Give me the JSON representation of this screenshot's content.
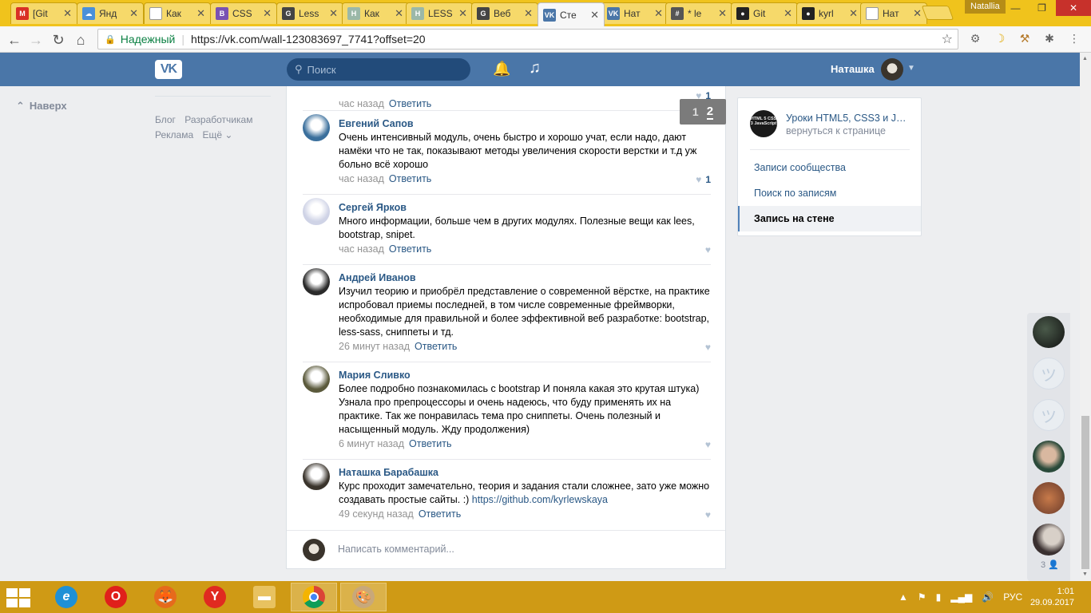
{
  "browser": {
    "tabs": [
      {
        "label": "[Git",
        "icon": "gmail-icon",
        "color": "#d93025",
        "glyph": "M"
      },
      {
        "label": "Янд",
        "icon": "yandex-weather-icon",
        "color": "#4a90d9",
        "glyph": "☁"
      },
      {
        "label": "Как",
        "icon": "page-icon",
        "color": "#ffffff",
        "glyph": ""
      },
      {
        "label": "CSS",
        "icon": "bootstrap-icon",
        "color": "#7952b3",
        "glyph": "B"
      },
      {
        "label": "Less",
        "icon": "geekbrains-icon",
        "color": "#444444",
        "glyph": "G"
      },
      {
        "label": "Как",
        "icon": "habr-icon",
        "color": "#9bb8a8",
        "glyph": "H"
      },
      {
        "label": "LESS",
        "icon": "habr-icon",
        "color": "#9bb8a8",
        "glyph": "H"
      },
      {
        "label": "Веб",
        "icon": "geekbrains-icon",
        "color": "#444444",
        "glyph": "G"
      },
      {
        "label": "Сте",
        "icon": "vk-icon",
        "color": "#4a76a8",
        "glyph": "VK",
        "active": true
      },
      {
        "label": "Нат",
        "icon": "vk-icon",
        "color": "#4a76a8",
        "glyph": "VK"
      },
      {
        "label": "* le",
        "icon": "slack-icon",
        "color": "#555555",
        "glyph": "#"
      },
      {
        "label": "Git",
        "icon": "github-icon",
        "color": "#222222",
        "glyph": "●"
      },
      {
        "label": "kyrl",
        "icon": "github-icon",
        "color": "#222222",
        "glyph": "●"
      },
      {
        "label": "Нат",
        "icon": "page-icon",
        "color": "#ffffff",
        "glyph": ""
      }
    ],
    "profile_name": "Natallia",
    "secure_label": "Надежный",
    "url": "https://vk.com/wall-123083697_7741?offset=20"
  },
  "vk": {
    "search_placeholder": "Поиск",
    "user_name": "Наташка",
    "up_button": "Наверх",
    "footer_links": [
      "Блог",
      "Разработчикам",
      "Реклама",
      "Ещё ⌄"
    ],
    "pager": {
      "prev": "1",
      "current": "2"
    },
    "comments": [
      {
        "author": "",
        "text": "",
        "time": "час назад",
        "reply": "Ответить",
        "likes": "1",
        "avatar_color": "#ffffff"
      },
      {
        "author": "Евгений Сапов",
        "text": "Очень интенсивный модуль, очень быстро и хорошо учат, если надо, дают намёки что не так, показывают методы увеличения скорости верстки и т.д уж больно всё хорошо",
        "time": "час назад",
        "reply": "Ответить",
        "likes": "1",
        "avatar_color": "#3a6f9c"
      },
      {
        "author": "Сергей Ярков",
        "text": "Много информации, больше чем в других модулях. Полезные вещи как lees, bootstrap, snipet.",
        "time": "час назад",
        "reply": "Ответить",
        "likes": "",
        "avatar_color": "#cfd3e6"
      },
      {
        "author": "Андрей Иванов",
        "text": "Изучил теорию и приобрёл представление о современной вёрстке, на практике испробовал приемы последней, в том числе современные фреймворки, необходимые для правильной и более эффективной веб разработке: bootstrap, less-sass, сниппеты и тд.",
        "time": "26 минут назад",
        "reply": "Ответить",
        "likes": "",
        "avatar_color": "#2b2b2b"
      },
      {
        "author": "Мария Сливко",
        "text": "Более подробно познакомилась с bootstrap И поняла какая это крутая штука) Узнала про препроцессоры и очень надеюсь, что буду применять их на практике. Так же понравилась тема про сниппеты. Очень полезный и насыщенный модуль. Жду продолжения)",
        "time": "6 минут назад",
        "reply": "Ответить",
        "likes": "",
        "avatar_color": "#5b5a3c"
      },
      {
        "author": "Наташка Барабашка",
        "text": "Курс проходит замечательно, теория и задания стали сложнее, зато уже можно создавать простые сайты. :) ",
        "link": "https://github.com/kyrlewskaya",
        "time": "49 секунд назад",
        "reply": "Ответить",
        "likes": "",
        "avatar_color": "#3a342c"
      }
    ],
    "write_placeholder": "Написать комментарий...",
    "right_menu": {
      "group_title": "Уроки HTML5, CSS3 и Ja...",
      "group_back": "вернуться к странице",
      "group_logo_text": "HTML 5 CSS 3 JavaScript",
      "items": [
        "Записи сообщества",
        "Поиск по записям",
        "Запись на стене"
      ]
    },
    "rail_count": "3"
  },
  "taskbar": {
    "lang": "РУС",
    "time": "1:01",
    "date": "29.09.2017"
  }
}
